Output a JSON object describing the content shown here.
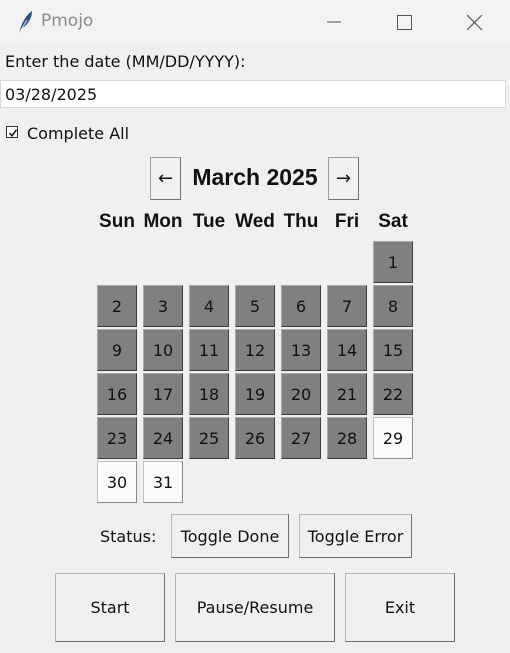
{
  "window": {
    "title": "Pmojo",
    "icon": "feather-icon"
  },
  "form": {
    "prompt": "Enter the date (MM/DD/YYYY):",
    "date_value": "03/28/2025",
    "complete_all_label": "Complete All",
    "complete_all_checked": true
  },
  "calendar": {
    "prev_label": "←",
    "next_label": "→",
    "month_title": "March 2025",
    "weekdays": [
      "Sun",
      "Mon",
      "Tue",
      "Wed",
      "Thu",
      "Fri",
      "Sat"
    ],
    "first_weekday_index": 6,
    "days": [
      {
        "n": "1",
        "done": true
      },
      {
        "n": "2",
        "done": true
      },
      {
        "n": "3",
        "done": true
      },
      {
        "n": "4",
        "done": true
      },
      {
        "n": "5",
        "done": true
      },
      {
        "n": "6",
        "done": true
      },
      {
        "n": "7",
        "done": true
      },
      {
        "n": "8",
        "done": true
      },
      {
        "n": "9",
        "done": true
      },
      {
        "n": "10",
        "done": true
      },
      {
        "n": "11",
        "done": true
      },
      {
        "n": "12",
        "done": true
      },
      {
        "n": "13",
        "done": true
      },
      {
        "n": "14",
        "done": true
      },
      {
        "n": "15",
        "done": true
      },
      {
        "n": "16",
        "done": true
      },
      {
        "n": "17",
        "done": true
      },
      {
        "n": "18",
        "done": true
      },
      {
        "n": "19",
        "done": true
      },
      {
        "n": "20",
        "done": true
      },
      {
        "n": "21",
        "done": true
      },
      {
        "n": "22",
        "done": true
      },
      {
        "n": "23",
        "done": true
      },
      {
        "n": "24",
        "done": true
      },
      {
        "n": "25",
        "done": true
      },
      {
        "n": "26",
        "done": true
      },
      {
        "n": "27",
        "done": true
      },
      {
        "n": "28",
        "done": true
      },
      {
        "n": "29",
        "done": false
      },
      {
        "n": "30",
        "done": false
      },
      {
        "n": "31",
        "done": false
      }
    ],
    "colors": {
      "done": "#808080",
      "not_done": "#fbfbfb"
    }
  },
  "status": {
    "label": "Status:",
    "toggle_done_label": "Toggle Done",
    "toggle_error_label": "Toggle Error"
  },
  "actions": {
    "start_label": "Start",
    "pause_label": "Pause/Resume",
    "exit_label": "Exit"
  }
}
